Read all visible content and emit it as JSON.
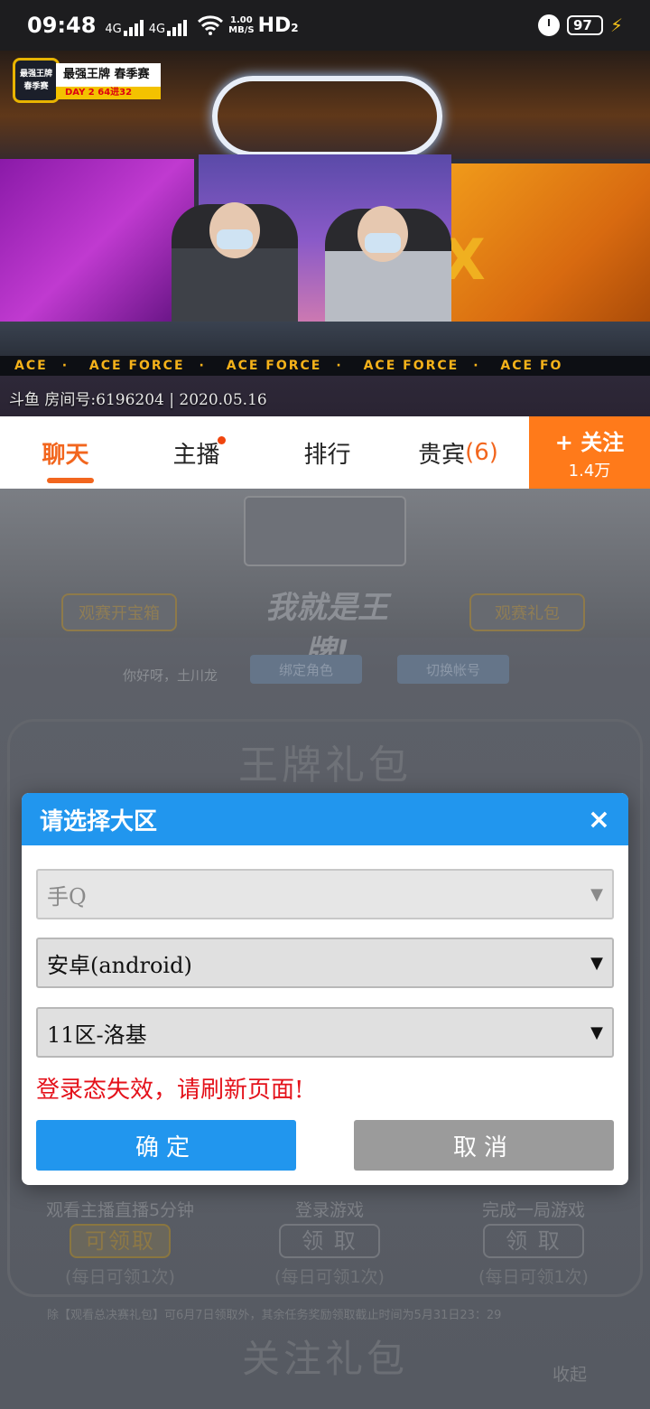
{
  "status_bar": {
    "time": "09:48",
    "network_1": "4G",
    "network_2": "4G",
    "speed_value": "1.00",
    "speed_unit": "MB/S",
    "hd": "HD",
    "hd_sub": "2",
    "battery": "97"
  },
  "video": {
    "logo_badge": "最强王牌 春季赛",
    "logo_title": "最强王牌 春季赛",
    "logo_sub": "DAY 2   64进32",
    "ticker": [
      "ACE",
      "ACE FORCE",
      "ACE FORCE",
      "ACE FORCE",
      "ACE FO"
    ],
    "watermark": "斗鱼 房间号:6196204 | 2020.05.16"
  },
  "tabs": {
    "chat": "聊天",
    "streamer": "主播",
    "ranking": "排行",
    "guests": "贵宾",
    "guest_count": "(6)"
  },
  "follow": {
    "label": "关注",
    "count": "1.4万"
  },
  "background_page": {
    "banner_title": "我就是王牌!",
    "btn_open_box": "观赛开宝箱",
    "btn_gift": "观赛礼包",
    "greeting": "你好呀，土川龙",
    "bind_role": "绑定角色",
    "switch_account": "切换帐号",
    "section_title": "王牌礼包",
    "tasks": [
      {
        "name": "观看主播直播5分钟",
        "button": "可领取",
        "note": "(每日可领1次)"
      },
      {
        "name": "登录游戏",
        "button": "领 取",
        "note": "(每日可领1次)"
      },
      {
        "name": "完成一局游戏",
        "button": "领 取",
        "note": "(每日可领1次)"
      }
    ],
    "notice": "除【观看总决赛礼包】可6月7日领取外，其余任务奖励领取截止时间为5月31日23：29",
    "follow_title": "关注礼包",
    "collapse": "收起"
  },
  "modal": {
    "title": "请选择大区",
    "close": "×",
    "select_platform": "手Q",
    "select_system": "安卓(android)",
    "select_server": "11区-洛基",
    "error": "登录态失效，请刷新页面!",
    "confirm": "确定",
    "cancel": "取消"
  },
  "colors": {
    "accent_orange": "#f2661e",
    "modal_blue": "#2196ee",
    "error_red": "#e4121b",
    "cancel_gray": "#9b9b9b"
  }
}
